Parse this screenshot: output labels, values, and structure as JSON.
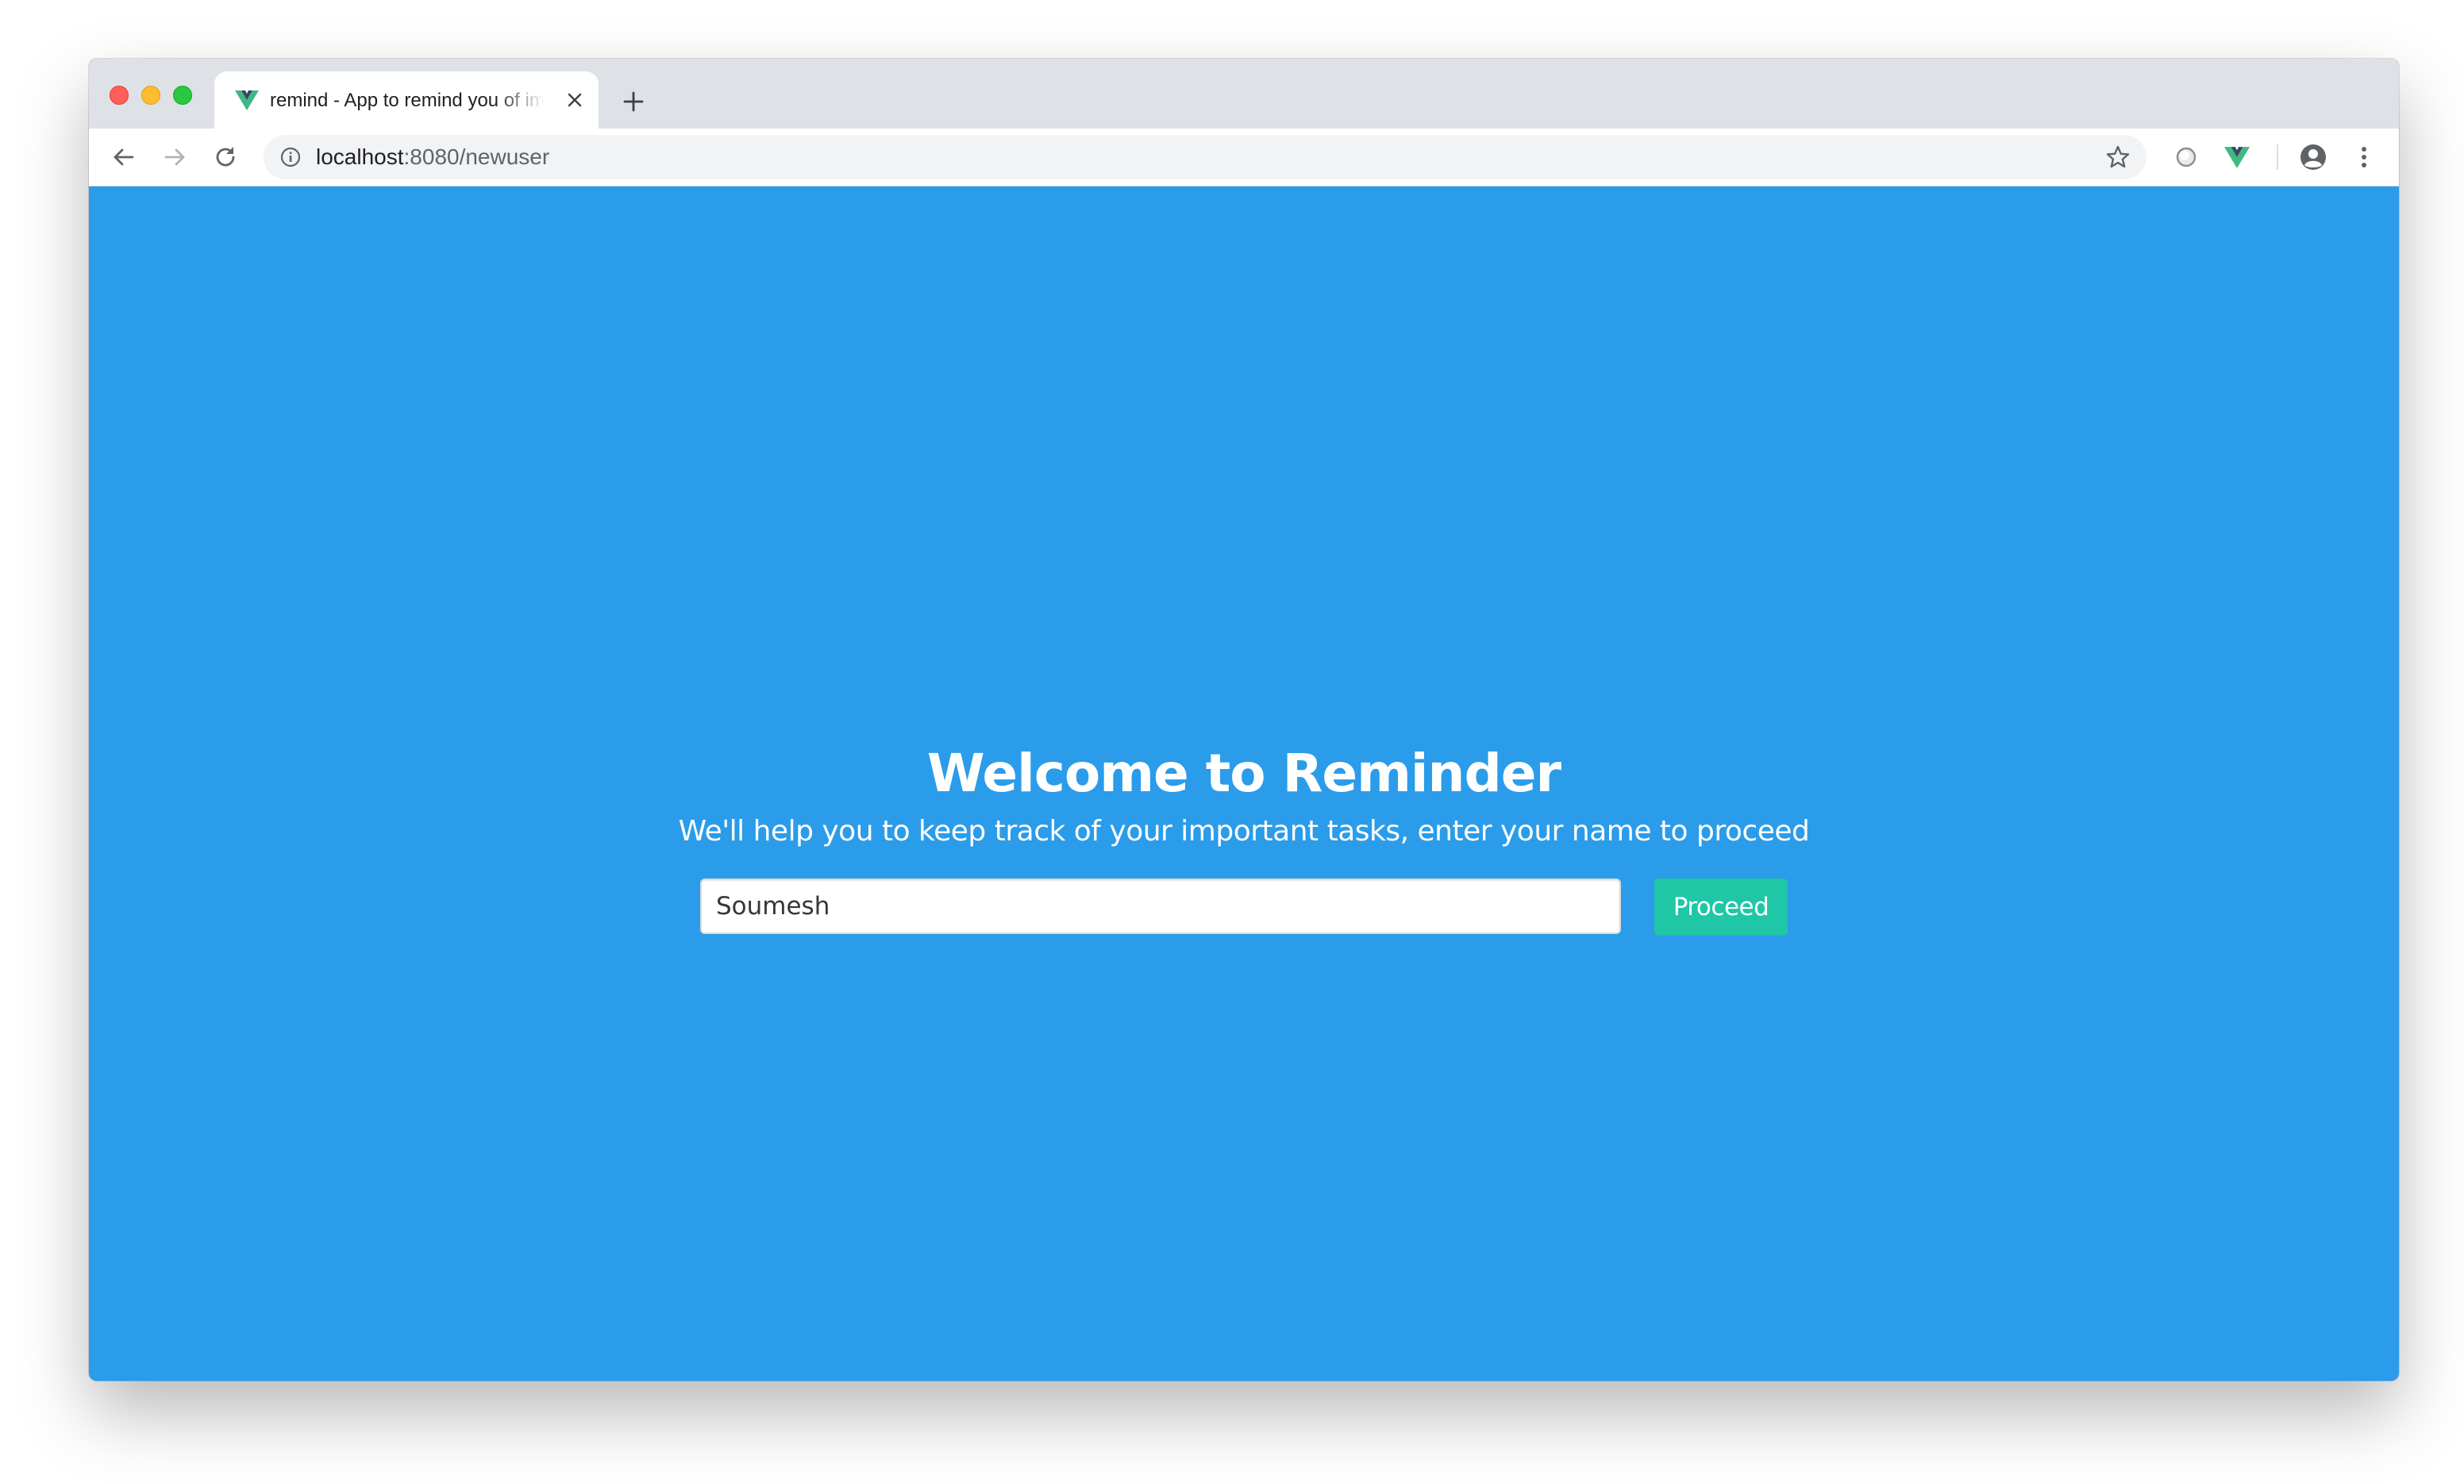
{
  "browser": {
    "tab": {
      "title": "remind - App to remind you of important tasks",
      "favicon": "vue-logo-icon"
    },
    "address": {
      "host": "localhost",
      "rest": ":8080/newuser"
    },
    "icons": {
      "back": "arrow-left-icon",
      "forward": "arrow-right-icon",
      "reload": "reload-icon",
      "info": "info-icon",
      "bookmark": "star-icon",
      "extension": "extension-circle-icon",
      "vue_devtools": "vue-logo-icon",
      "profile": "account-circle-icon",
      "menu": "kebab-menu-icon"
    }
  },
  "page": {
    "title": "Welcome to Reminder",
    "subtitle": "We'll help you to keep track of your important tasks, enter your name to proceed",
    "name_input": {
      "value": "Soumesh"
    },
    "proceed_label": "Proceed"
  },
  "colors": {
    "background": "#2a9cea",
    "button": "#1fc7a6",
    "text": "#ffffff"
  }
}
